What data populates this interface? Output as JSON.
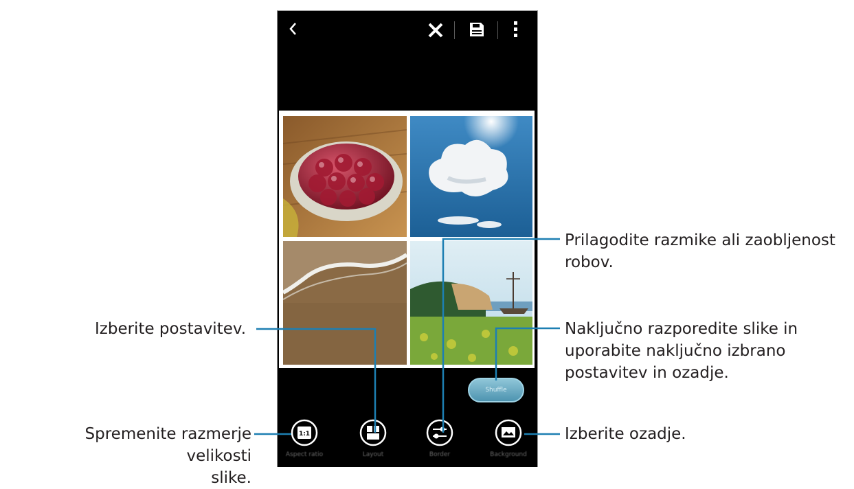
{
  "toolbar": {
    "back_icon": "chevron-left-icon",
    "discard_icon": "close-icon",
    "save_icon": "save-icon",
    "more_icon": "more-vertical-icon"
  },
  "collage": {
    "photos": [
      {
        "name": "strawberry-tart-photo"
      },
      {
        "name": "cloud-sky-photo"
      },
      {
        "name": "beach-wave-photo"
      },
      {
        "name": "coast-ship-photo"
      }
    ]
  },
  "shuffle_button": {
    "label": "Shuffle"
  },
  "tools": [
    {
      "label": "Aspect ratio",
      "icon": "aspect-ratio-icon"
    },
    {
      "label": "Layout",
      "icon": "layout-icon"
    },
    {
      "label": "Border",
      "icon": "border-adjust-icon"
    },
    {
      "label": "Background",
      "icon": "background-icon"
    }
  ],
  "callouts": {
    "aspect_ratio": "Spremenite razmerje velikosti slike.",
    "aspect_ratio_line1": "Spremenite razmerje velikosti",
    "aspect_ratio_line2": "slike.",
    "layout": "Izberite postavitev.",
    "border_line1": "Prilagodite razmike ali zaobljenost",
    "border_line2": "robov.",
    "shuffle_line1": "Naključno razporedite slike in",
    "shuffle_line2": "uporabite naključno izbrano",
    "shuffle_line3": "postavitev in ozadje.",
    "background": "Izberite ozadje."
  },
  "colors": {
    "callout_line": "#1d7fb2",
    "phone_bg": "#000000",
    "shuffle_button": "#6fb0c9"
  }
}
